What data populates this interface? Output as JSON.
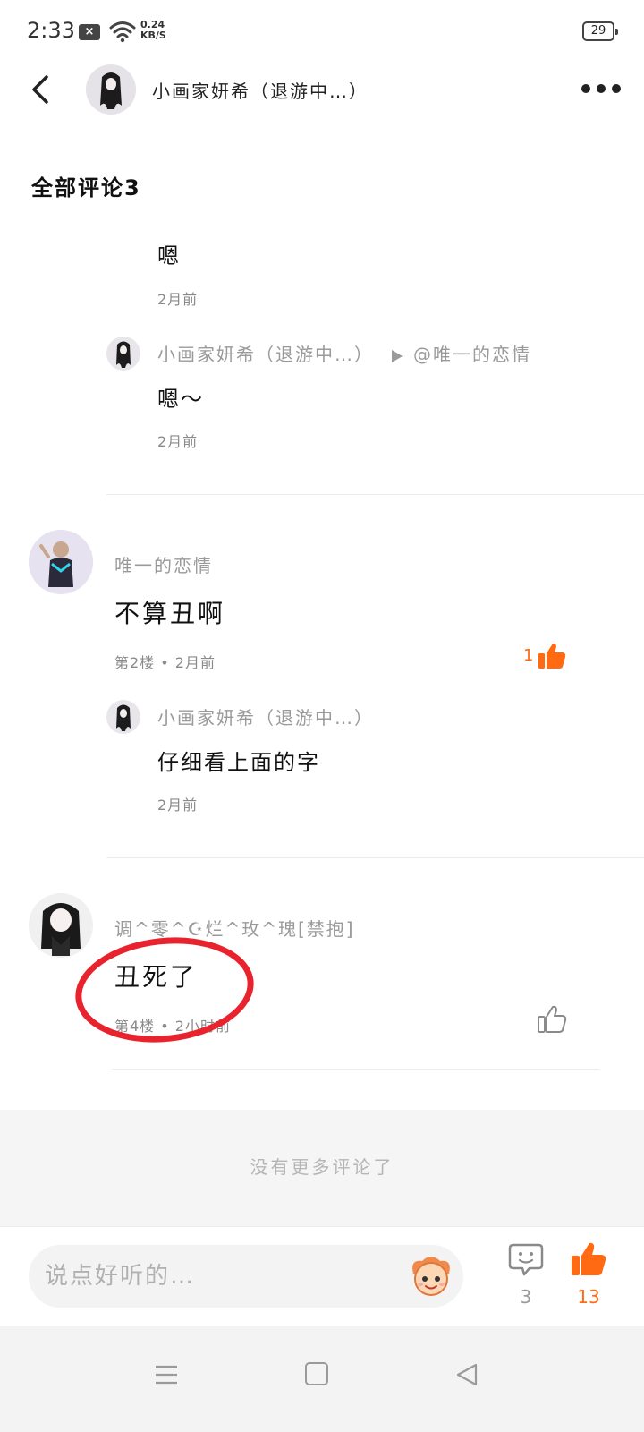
{
  "status_bar": {
    "time": "2:33",
    "net_speed_value": "0.24",
    "net_speed_unit": "KB/S",
    "battery": "29"
  },
  "header": {
    "title": "小画家妍希（退游中…）"
  },
  "section_title": "全部评论3",
  "thread1": {
    "reply_text": "嗯",
    "reply_time": "2月前",
    "sub_reply": {
      "author": "小画家妍希（退游中…）",
      "target": "@唯一的恋情",
      "text": "嗯～",
      "time": "2月前"
    }
  },
  "comment2": {
    "author": "唯一的恋情",
    "text": "不算丑啊",
    "meta": "第2楼 • 2月前",
    "likes": "1",
    "reply": {
      "author": "小画家妍希（退游中…）",
      "text": "仔细看上面的字",
      "time": "2月前"
    }
  },
  "comment3": {
    "author": "调^零^☪烂^玫^瑰[禁抱]",
    "text": "丑死了",
    "meta": "第4楼 • 2小时前"
  },
  "no_more_text": "没有更多评论了",
  "bottom_bar": {
    "input_placeholder": "说点好听的…",
    "comment_count": "3",
    "like_count": "13"
  },
  "colors": {
    "accent": "#ff6a13",
    "annotation": "#e8232e",
    "muted": "#9a9a9a"
  }
}
